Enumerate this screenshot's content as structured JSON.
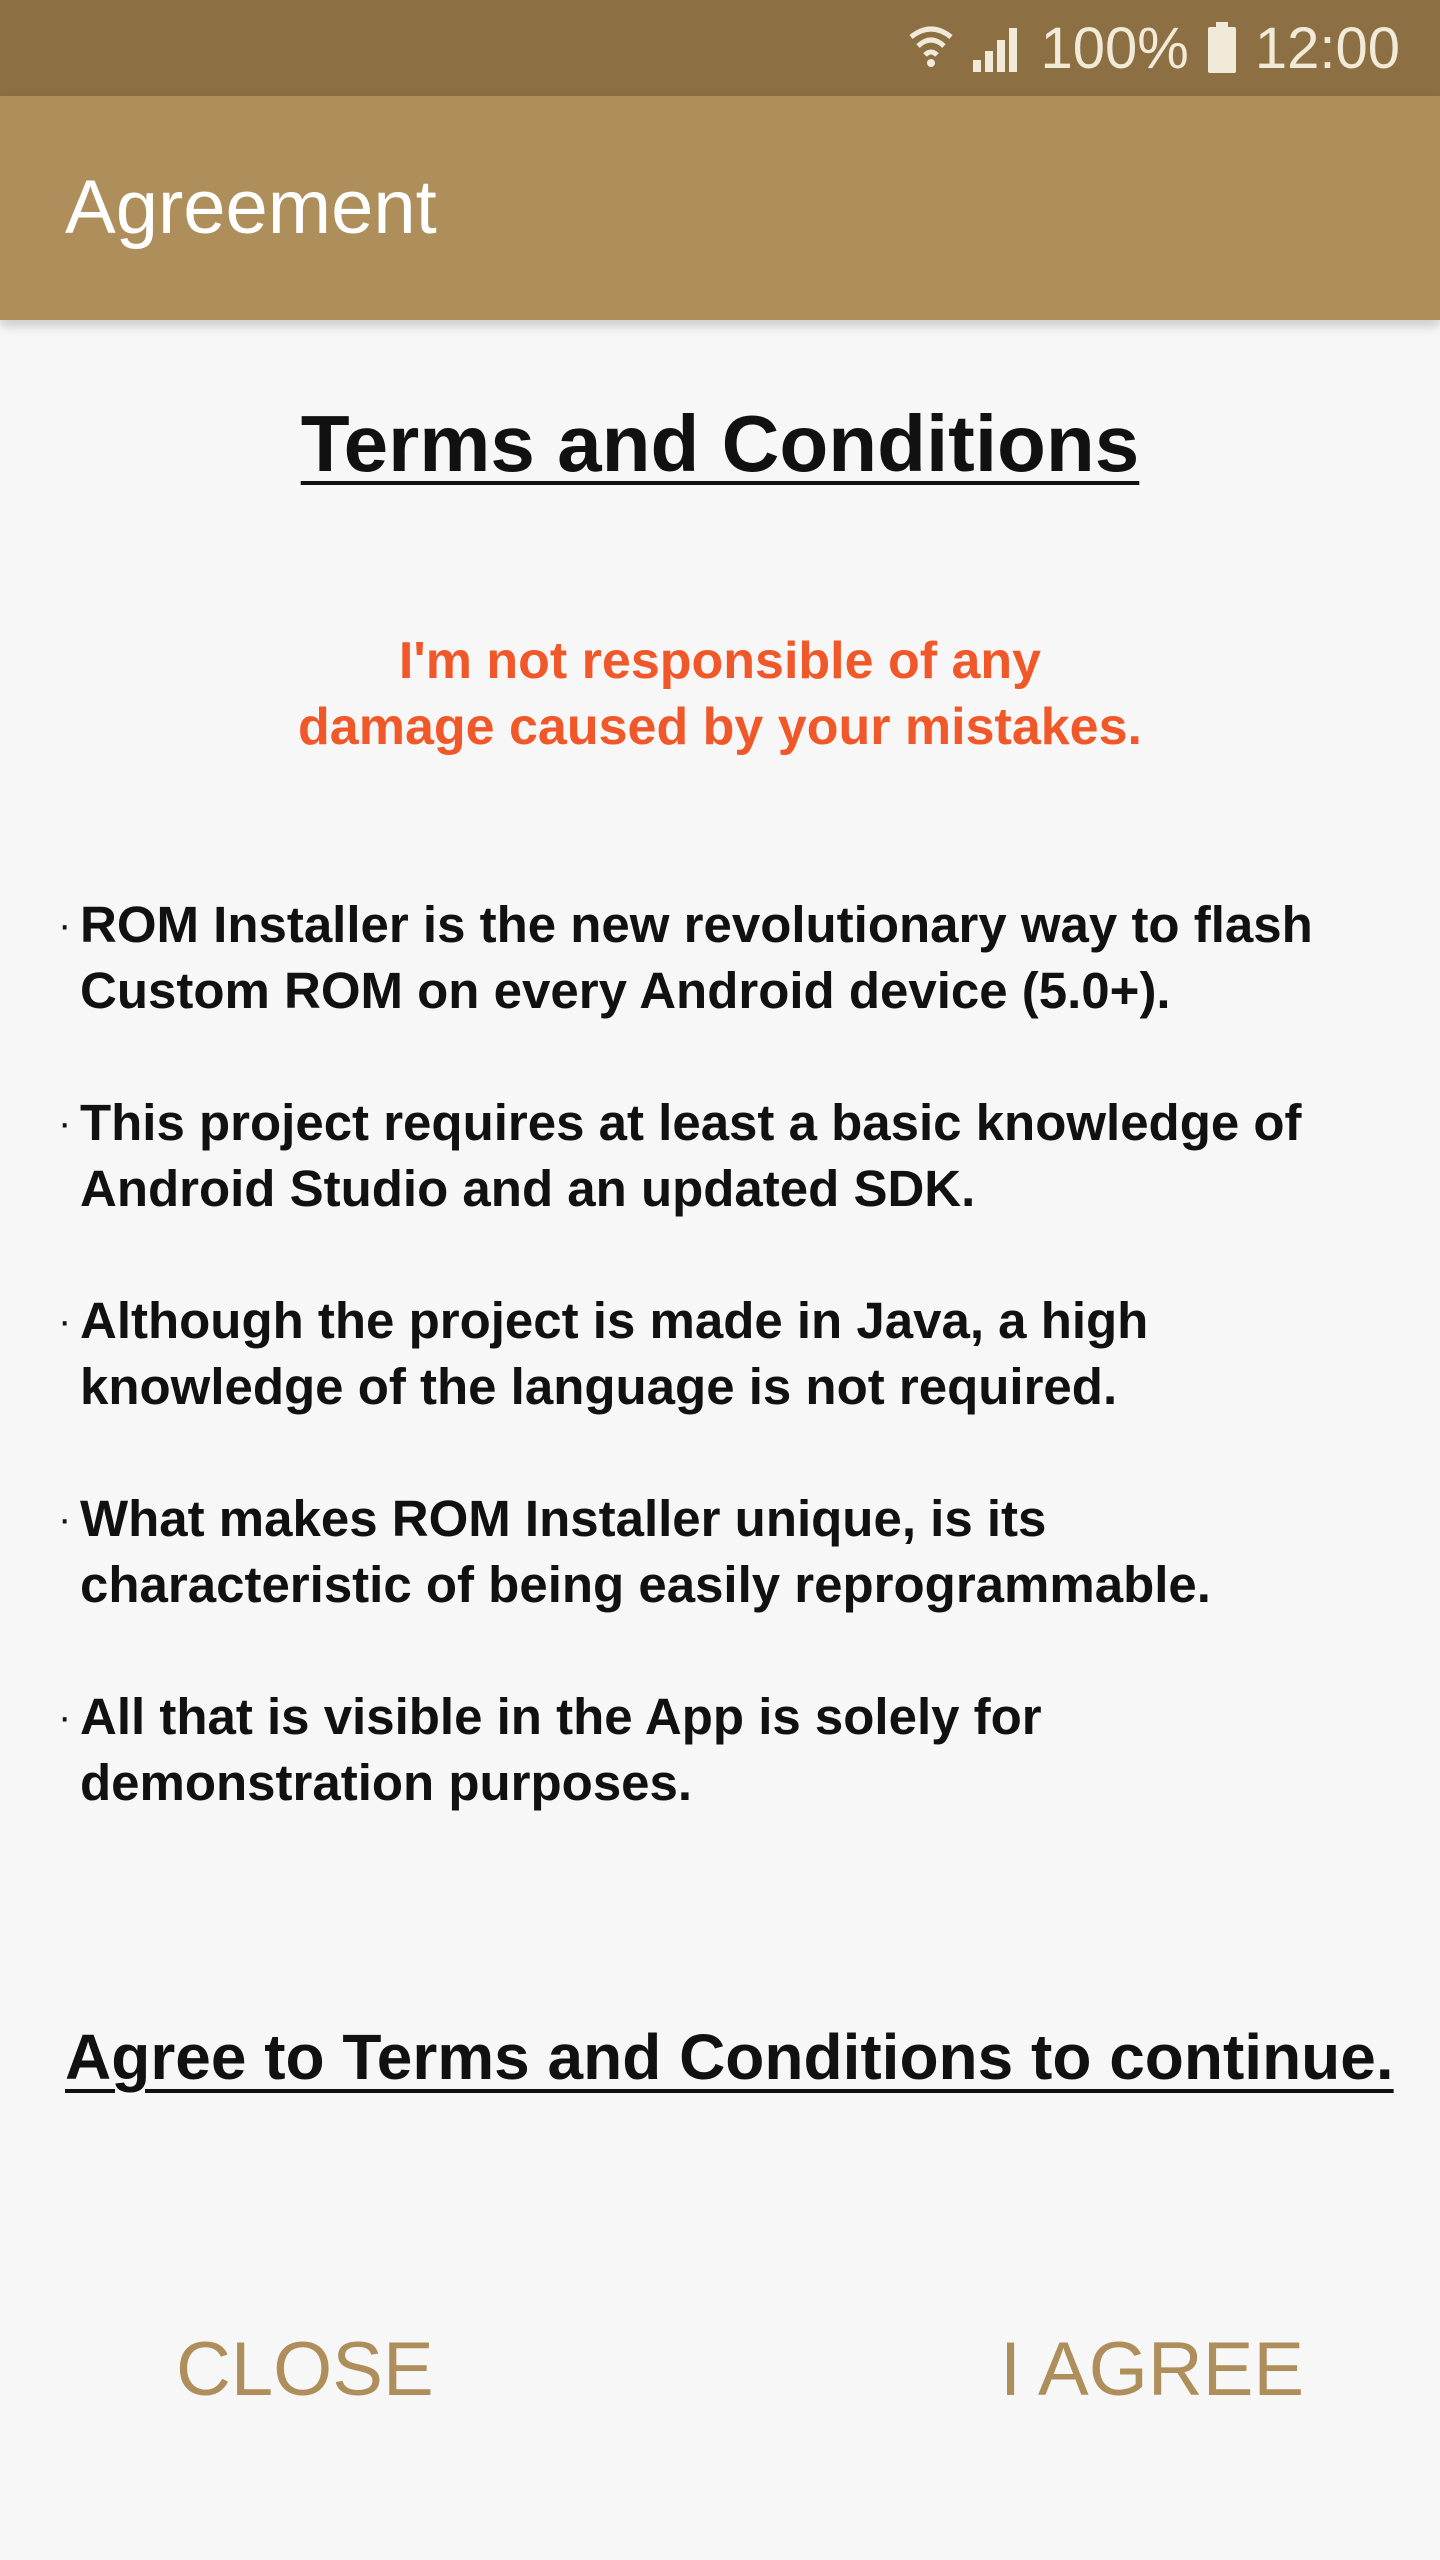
{
  "status_bar": {
    "battery_percent": "100%",
    "time": "12:00",
    "icons": [
      "wifi-icon",
      "signal-icon",
      "battery-icon"
    ]
  },
  "app_bar": {
    "title": "Agreement"
  },
  "content": {
    "heading": "Terms and Conditions",
    "warning_lines": [
      "I'm not responsible of any",
      "damage caused by your mistakes."
    ],
    "bullets": [
      {
        "lines": [
          "ROM Installer is the new revolutionary way to flash",
          "Custom ROM on every Android device (5.0+)."
        ]
      },
      {
        "lines": [
          "This project requires at least a basic knowledge of",
          "Android Studio and an updated SDK."
        ]
      },
      {
        "lines": [
          "Although the project is made in Java, a high",
          "knowledge of the language is not required."
        ]
      },
      {
        "lines": [
          "What makes ROM Installer unique, is its",
          "characteristic of being easily reprogrammable."
        ]
      },
      {
        "lines": [
          "All that is visible in the App is solely for",
          "demonstration purposes."
        ]
      }
    ],
    "bullet_marker": "·",
    "agree_note": "Agree to Terms and Conditions to continue."
  },
  "actions": {
    "close_label": "CLOSE",
    "agree_label": "I AGREE"
  },
  "colors": {
    "status_bar": "#8c6f43",
    "app_bar": "#ae8f5b",
    "accent": "#ae8f5b",
    "warning": "#f0582a",
    "background": "#f7f7f7"
  }
}
